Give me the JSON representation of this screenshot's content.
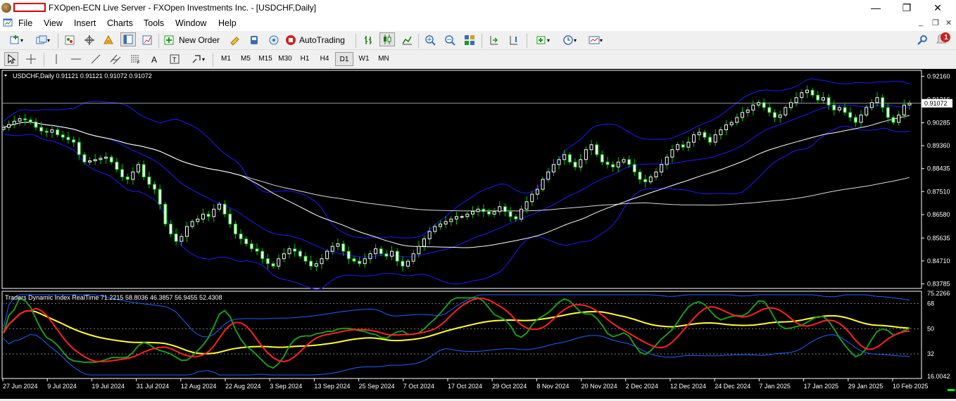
{
  "window": {
    "title": "FXOpen-ECN Live Server - FXOpen Investments Inc. - [USDCHF,Daily]",
    "controls": {
      "minimize": "—",
      "maximize": "❐",
      "close": "✕"
    }
  },
  "menu": {
    "items": [
      "File",
      "View",
      "Insert",
      "Charts",
      "Tools",
      "Window",
      "Help"
    ],
    "mdi_controls": {
      "minimize": "_",
      "restore": "❐",
      "close": "✕"
    }
  },
  "toolbar": {
    "new_order_label": "New Order",
    "autotrading_label": "AutoTrading",
    "notification_count": "1"
  },
  "timeframes": [
    "M1",
    "M5",
    "M15",
    "M30",
    "H1",
    "H4",
    "D1",
    "W1",
    "MN"
  ],
  "active_timeframe": "D1",
  "chart": {
    "symbol_info": "USDCHF,Daily  0.91121 0.91121 0.91072 0.91072",
    "current_price": "0.91072",
    "price_axis": [
      "0.92160",
      "0.91216",
      "0.90285",
      "0.89360",
      "0.88435",
      "0.87510",
      "0.86580",
      "0.85635",
      "0.84710",
      "0.83785"
    ],
    "date_axis": [
      "27 Jun 2024",
      "9 Jul 2024",
      "19 Jul 2024",
      "31 Jul 2024",
      "12 Aug 2024",
      "22 Aug 2024",
      "3 Sep 2024",
      "13 Sep 2024",
      "25 Sep 2024",
      "7 Oct 2024",
      "17 Oct 2024",
      "29 Oct 2024",
      "8 Nov 2024",
      "20 Nov 2024",
      "2 Dec 2024",
      "12 Dec 2024",
      "24 Dec 2024",
      "7 Jan 2025",
      "17 Jan 2025",
      "29 Jan 2025",
      "10 Feb 2025"
    ],
    "indicator_label": "Traders Dynamic Index RealTime 71.2215 58.8036 46.3857 56.9455 52.4308",
    "indicator_axis": [
      "75.2266",
      "68",
      "50",
      "32",
      "16.0042"
    ],
    "colors": {
      "background": "#000000",
      "bull": "#ffffff",
      "bear": "#ffffff",
      "bollinger": "#1a1aff",
      "ma_fast": "#ffffff",
      "ma_slow": "#ffffff",
      "tdi_green": "#1a9a1a",
      "tdi_red": "#ff2020",
      "tdi_yellow": "#ffff30",
      "tdi_band": "#2060ff",
      "accent_green": "#00ff00"
    }
  },
  "chart_data": {
    "type": "candlestick",
    "symbol": "USDCHF",
    "timeframe": "Daily",
    "ohlc_last": {
      "open": 0.91121,
      "high": 0.91121,
      "low": 0.91072,
      "close": 0.91072
    },
    "ylim": [
      0.836,
      0.924
    ],
    "close": [
      0.901,
      0.9022,
      0.9035,
      0.9045,
      0.904,
      0.9032,
      0.901,
      0.8995,
      0.899,
      0.9,
      0.898,
      0.897,
      0.896,
      0.895,
      0.89,
      0.887,
      0.8875,
      0.888,
      0.8885,
      0.889,
      0.887,
      0.884,
      0.881,
      0.88,
      0.883,
      0.886,
      0.881,
      0.878,
      0.876,
      0.87,
      0.862,
      0.858,
      0.855,
      0.857,
      0.861,
      0.863,
      0.864,
      0.866,
      0.865,
      0.868,
      0.87,
      0.866,
      0.862,
      0.858,
      0.856,
      0.854,
      0.852,
      0.851,
      0.848,
      0.846,
      0.845,
      0.848,
      0.85,
      0.852,
      0.851,
      0.849,
      0.847,
      0.845,
      0.846,
      0.848,
      0.851,
      0.853,
      0.854,
      0.851,
      0.848,
      0.847,
      0.846,
      0.848,
      0.85,
      0.852,
      0.85,
      0.849,
      0.851,
      0.847,
      0.845,
      0.847,
      0.85,
      0.853,
      0.856,
      0.859,
      0.861,
      0.862,
      0.863,
      0.864,
      0.865,
      0.865,
      0.866,
      0.867,
      0.868,
      0.867,
      0.866,
      0.867,
      0.869,
      0.867,
      0.865,
      0.864,
      0.868,
      0.871,
      0.874,
      0.876,
      0.88,
      0.883,
      0.886,
      0.888,
      0.89,
      0.887,
      0.885,
      0.888,
      0.892,
      0.894,
      0.89,
      0.887,
      0.886,
      0.885,
      0.887,
      0.888,
      0.886,
      0.883,
      0.88,
      0.879,
      0.881,
      0.883,
      0.886,
      0.889,
      0.892,
      0.894,
      0.893,
      0.895,
      0.898,
      0.899,
      0.897,
      0.895,
      0.898,
      0.9,
      0.902,
      0.903,
      0.905,
      0.907,
      0.908,
      0.91,
      0.911,
      0.909,
      0.907,
      0.905,
      0.906,
      0.909,
      0.911,
      0.913,
      0.915,
      0.916,
      0.914,
      0.912,
      0.913,
      0.91,
      0.908,
      0.909,
      0.907,
      0.905,
      0.903,
      0.906,
      0.909,
      0.911,
      0.913,
      0.909,
      0.905,
      0.903,
      0.906,
      0.91,
      0.9107
    ],
    "price_axis_ticks": [
      0.9216,
      0.91216,
      0.90285,
      0.8936,
      0.88435,
      0.8751,
      0.8658,
      0.85635,
      0.8471,
      0.83785
    ],
    "indicator": {
      "name": "Traders Dynamic Index RealTime",
      "values": [
        71.2215,
        58.8036,
        46.3857,
        56.9455,
        52.4308
      ],
      "ylim": [
        16.0042,
        75.2266
      ],
      "levels": [
        68,
        50,
        32
      ]
    }
  }
}
